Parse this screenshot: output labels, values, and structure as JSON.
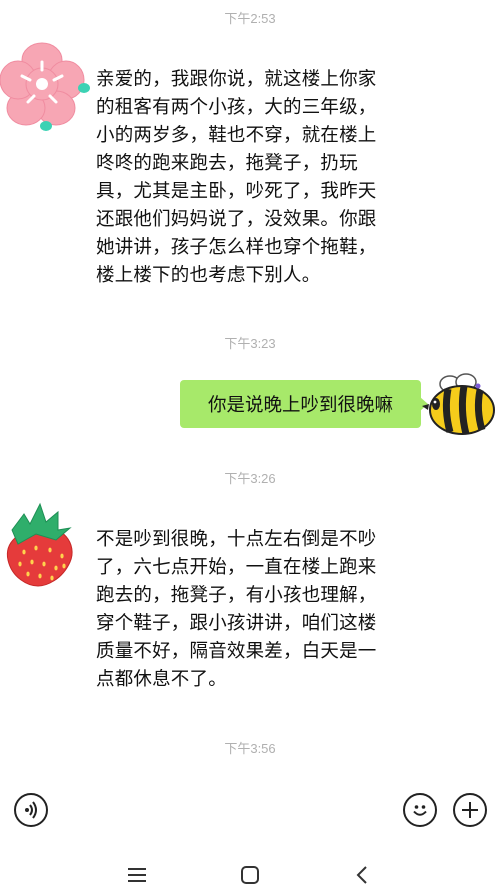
{
  "timestamps": [
    "下午2:53",
    "下午3:23",
    "下午3:26",
    "下午3:56"
  ],
  "messages": [
    {
      "side": "left",
      "avatar": "pink-flower-avatar",
      "text": "亲爱的，我跟你说，就这楼上你家\n的租客有两个小孩，大的三年级，\n小的两岁多，鞋也不穿，就在楼上\n咚咚的跑来跑去，拖凳子，扔玩\n具，尤其是主卧，吵死了，我昨天\n还跟他们妈妈说了，没效果。你跟\n她讲讲，孩子怎么样也穿个拖鞋，\n楼上楼下的也考虑下别人。"
    },
    {
      "side": "right",
      "avatar": "bee-avatar",
      "text": "你是说晚上吵到很晚嘛",
      "bubble_color": "#a7e96a"
    },
    {
      "side": "left",
      "avatar": "strawberry-avatar",
      "text": "不是吵到很晚，十点左右倒是不吵\n了，六七点开始，一直在楼上跑来\n跑去的，拖凳子，有小孩也理解，\n穿个鞋子，跟小孩讲讲，咱们这楼\n质量不好，隔音效果差，白天是一\n点都休息不了。"
    }
  ],
  "input_bar": {
    "left_icon": "voice-icon",
    "right_icons": [
      "emoji-icon",
      "plus-icon"
    ]
  },
  "nav_bar": [
    "menu-icon",
    "home-icon",
    "back-icon"
  ]
}
